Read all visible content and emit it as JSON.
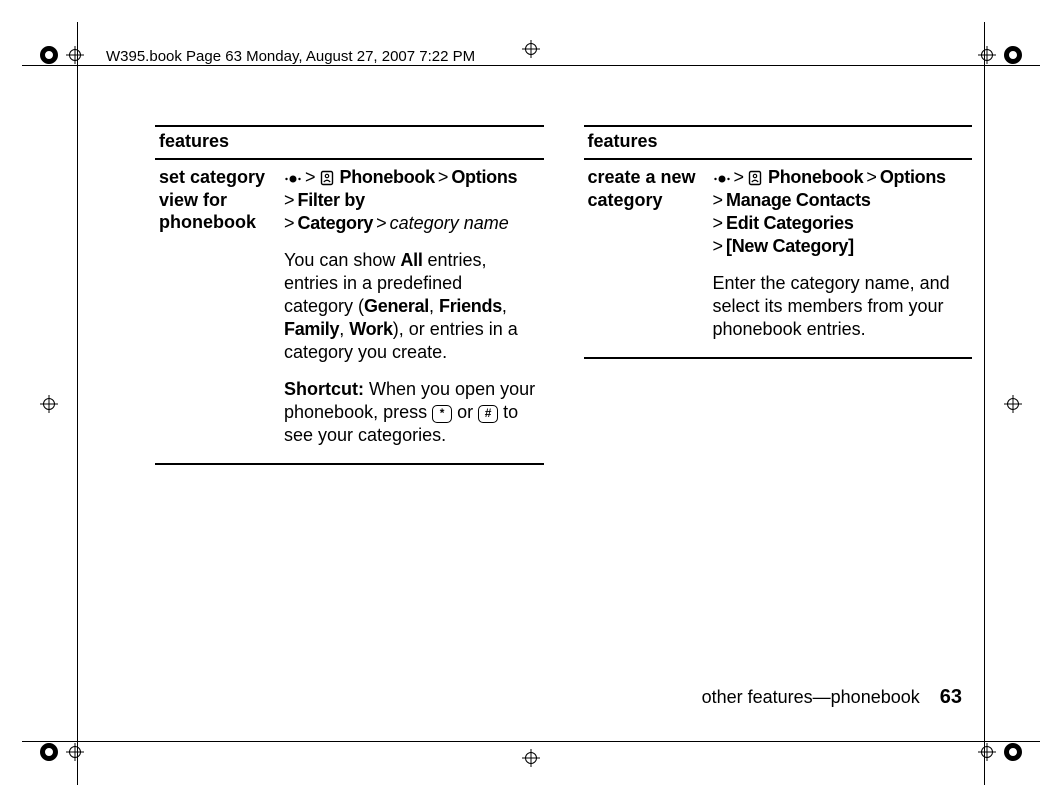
{
  "header": "W395.book  Page 63  Monday, August 27, 2007  7:22 PM",
  "left": {
    "heading": "features",
    "rowLabel": "set category view for phonebook",
    "path": {
      "gt": ">",
      "phonebook": "Phonebook",
      "options": "Options",
      "filterBy": "Filter by",
      "category": "Category",
      "catName": "category name"
    },
    "p1a": "You can show ",
    "all": "All",
    "p1b": " entries, entries in a predefined category (",
    "general": "General",
    "comma": ", ",
    "friends": "Friends",
    "family": "Family",
    "work": "Work",
    "p1c": "), or entries in a category you create.",
    "shortcutLabel": "Shortcut:",
    "p2a": " When you open your phonebook, press ",
    "keyStar": "*",
    "or": " or ",
    "keyHash": "#",
    "p2b": " to see your categories."
  },
  "right": {
    "heading": "features",
    "rowLabel": "create a new category",
    "path": {
      "gt": ">",
      "phonebook": "Phonebook",
      "options": "Options",
      "manage": "Manage Contacts",
      "edit": "Edit Categories",
      "newCat": "[New Category]"
    },
    "p1": "Enter the category name, and select its members from your phonebook entries."
  },
  "footer": {
    "text": "other features—phonebook",
    "page": "63"
  }
}
